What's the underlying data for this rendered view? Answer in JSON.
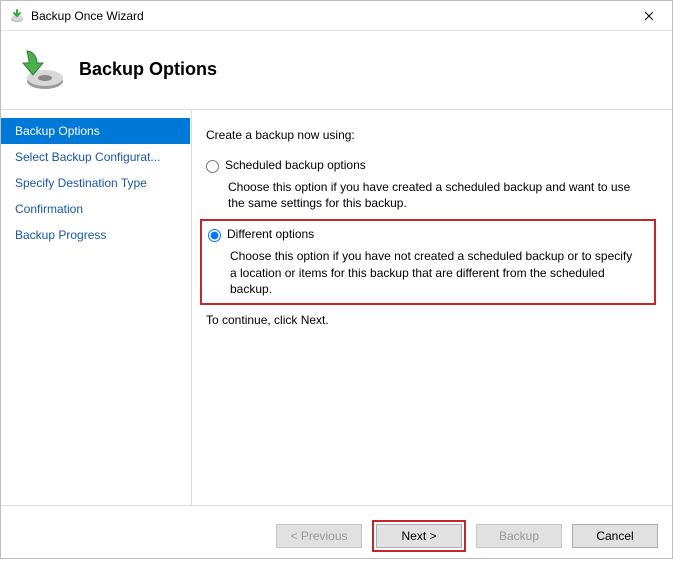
{
  "window": {
    "title": "Backup Once Wizard"
  },
  "header": {
    "title": "Backup Options"
  },
  "sidebar": {
    "items": [
      {
        "label": "Backup Options",
        "selected": true
      },
      {
        "label": "Select Backup Configurat...",
        "selected": false
      },
      {
        "label": "Specify Destination Type",
        "selected": false
      },
      {
        "label": "Confirmation",
        "selected": false
      },
      {
        "label": "Backup Progress",
        "selected": false
      }
    ]
  },
  "main": {
    "intro": "Create a backup now using:",
    "option1": {
      "label": "Scheduled backup options",
      "desc": "Choose this option if you have created a scheduled backup and want to use the same settings for this backup."
    },
    "option2": {
      "label": "Different options",
      "desc": "Choose this option if you have not created a scheduled backup or to specify a location or items for this backup that are different from the scheduled backup."
    },
    "continue": "To continue, click Next."
  },
  "footer": {
    "previous": "< Previous",
    "next": "Next >",
    "backup": "Backup",
    "cancel": "Cancel"
  }
}
